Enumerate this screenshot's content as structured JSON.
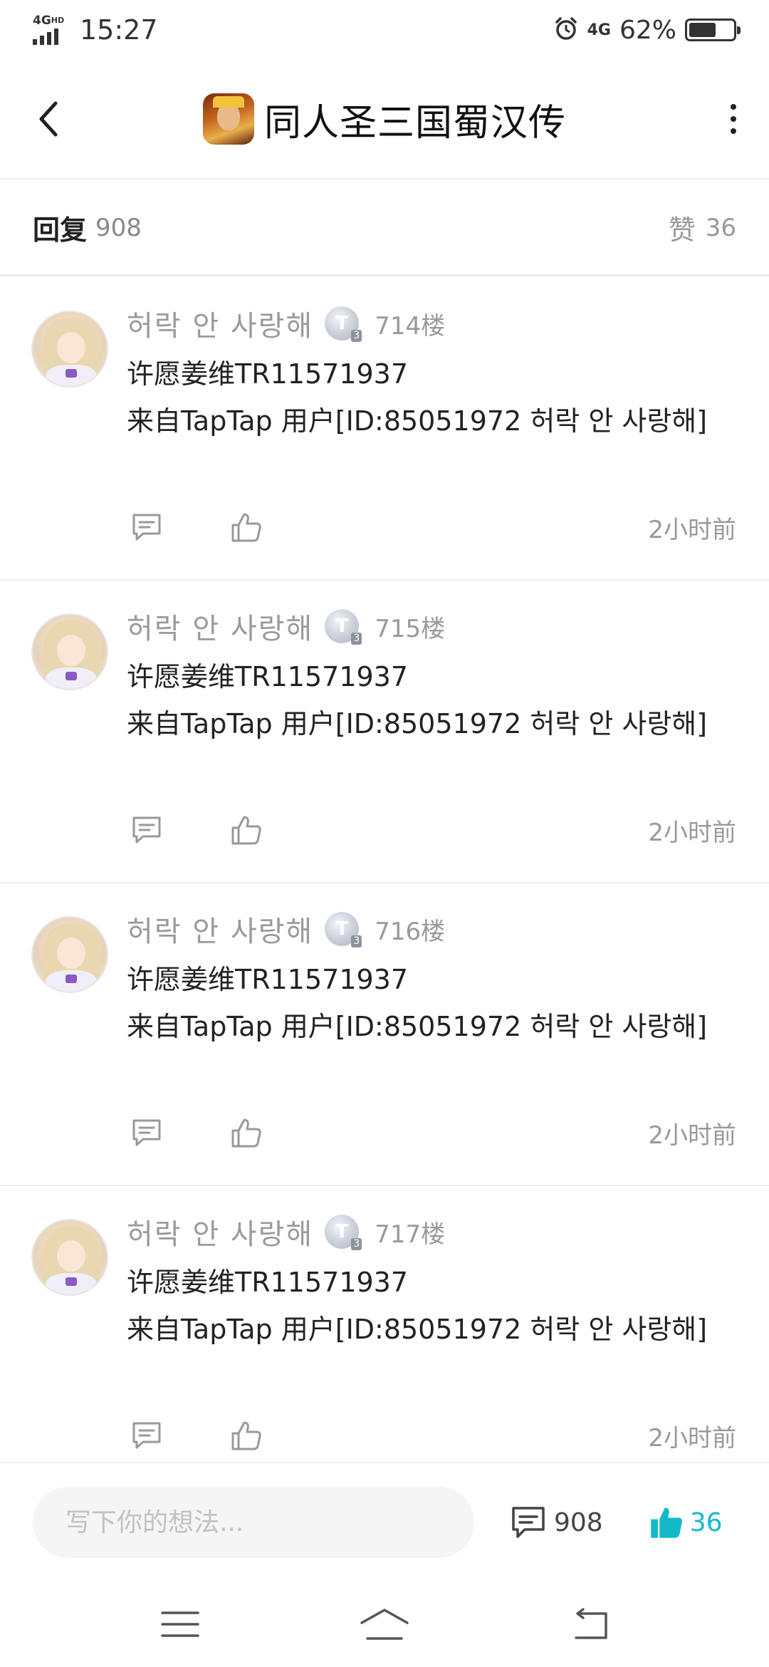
{
  "status_bar": {
    "network": "4G",
    "network_hd": "HD",
    "time": "15:27",
    "mobile_4g": "4G",
    "battery_percent": "62%",
    "battery_level": 0.62
  },
  "header": {
    "title": "同人圣三国蜀汉传"
  },
  "summary": {
    "reply_label": "回复",
    "reply_count": "908",
    "like_label": "赞",
    "like_count": "36"
  },
  "replies": [
    {
      "username": "허락 안 사랑해",
      "badge_letter": "T",
      "badge_level": "3",
      "floor": "714楼",
      "line1": "许愿姜维TR11571937",
      "line2": "来自TapTap 用户[ID:85051972 허락 안 사랑해]",
      "time": "2小时前"
    },
    {
      "username": "허락 안 사랑해",
      "badge_letter": "T",
      "badge_level": "3",
      "floor": "715楼",
      "line1": "许愿姜维TR11571937",
      "line2": "来自TapTap 用户[ID:85051972 허락 안 사랑해]",
      "time": "2小时前"
    },
    {
      "username": "허락 안 사랑해",
      "badge_letter": "T",
      "badge_level": "3",
      "floor": "716楼",
      "line1": "许愿姜维TR11571937",
      "line2": "来自TapTap 用户[ID:85051972 허락 안 사랑해]",
      "time": "2小时前"
    },
    {
      "username": "허락 안 사랑해",
      "badge_letter": "T",
      "badge_level": "3",
      "floor": "717楼",
      "line1": "许愿姜维TR11571937",
      "line2": "来自TapTap 用户[ID:85051972 허락 안 사랑해]",
      "time": "2小时前"
    }
  ],
  "bottom_bar": {
    "input_placeholder": "写下你的想法...",
    "comment_count": "908",
    "like_count": "36",
    "like_color": "#14b9c8"
  },
  "icons": {
    "back": "chevron-left-icon",
    "more": "more-vertical-icon",
    "comment": "comment-icon",
    "like": "thumbs-up-icon",
    "nav_menu": "menu-icon",
    "nav_home": "home-icon",
    "nav_back": "back-icon"
  }
}
